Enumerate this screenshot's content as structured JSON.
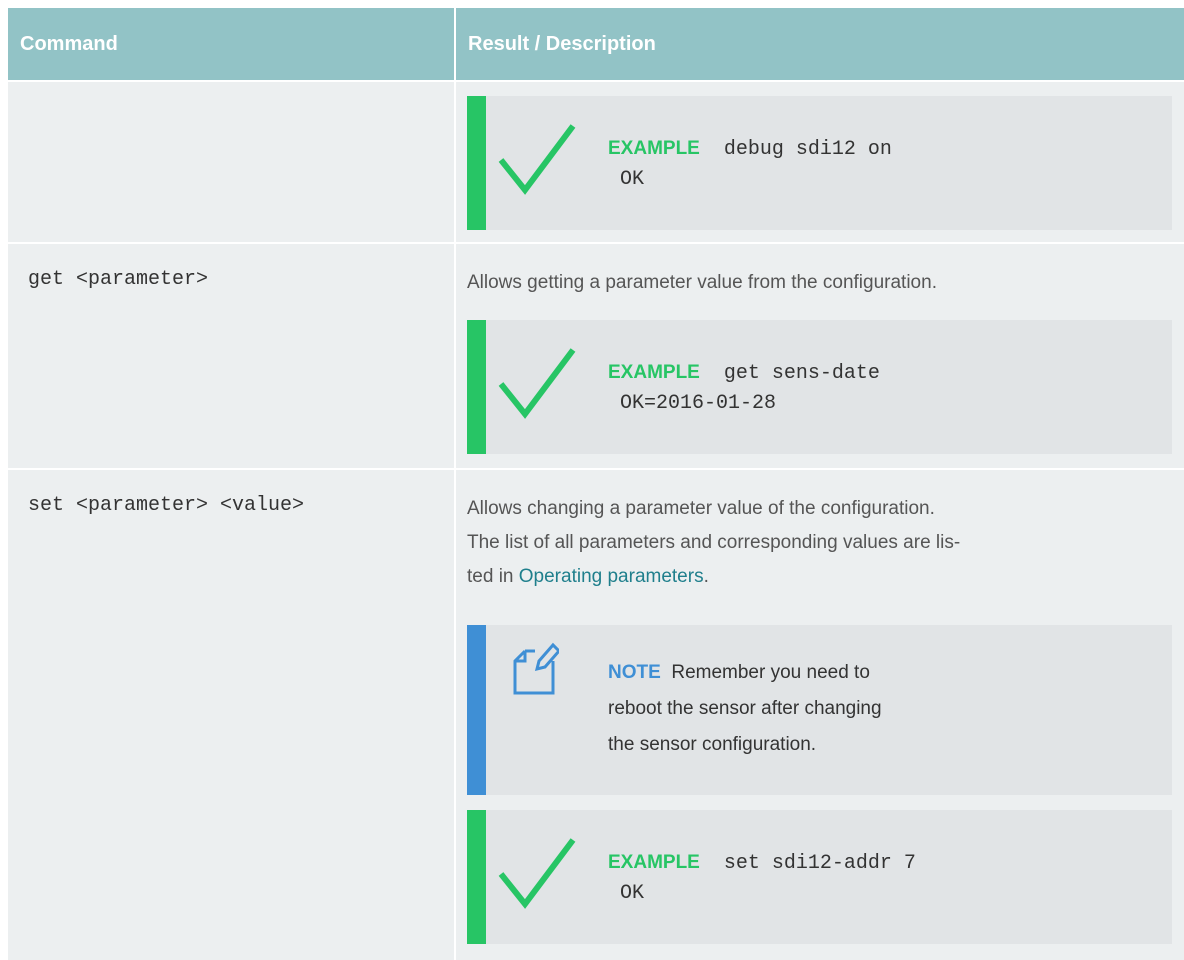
{
  "header": {
    "col1": "Command",
    "col2": "Result / Description"
  },
  "rows": [
    {
      "command": "",
      "description": "",
      "example": {
        "label": "EXAMPLE",
        "line1": "debug sdi12 on",
        "line2": "OK"
      }
    },
    {
      "command": "get <parameter>",
      "description": "Allows getting a parameter value from the configuration.",
      "example": {
        "label": "EXAMPLE",
        "line1": "get sens-date",
        "line2": "OK=2016-01-28"
      }
    },
    {
      "command": "set <parameter> <value>",
      "description_line1": "Allows changing a parameter value of the configuration.",
      "description_line2": "The list of all parameters and corresponding values are lis-",
      "description_line3_prefix": "ted in ",
      "description_link": "Operating parameters",
      "description_line3_suffix": ".",
      "note": {
        "label": "NOTE",
        "text": "Remember you need to reboot the sensor after changing the sensor configuration."
      },
      "example": {
        "label": "EXAMPLE",
        "line1": "set sdi12-addr 7",
        "line2": "OK"
      }
    }
  ],
  "colors": {
    "header": "#92c3c6",
    "cell": "#eceff0",
    "box": "#e1e4e6",
    "green": "#27c565",
    "blue": "#3f8fd5",
    "link": "#1f7f8c"
  },
  "icons": {
    "example": "checkmark-icon",
    "note": "note-edit-icon"
  }
}
